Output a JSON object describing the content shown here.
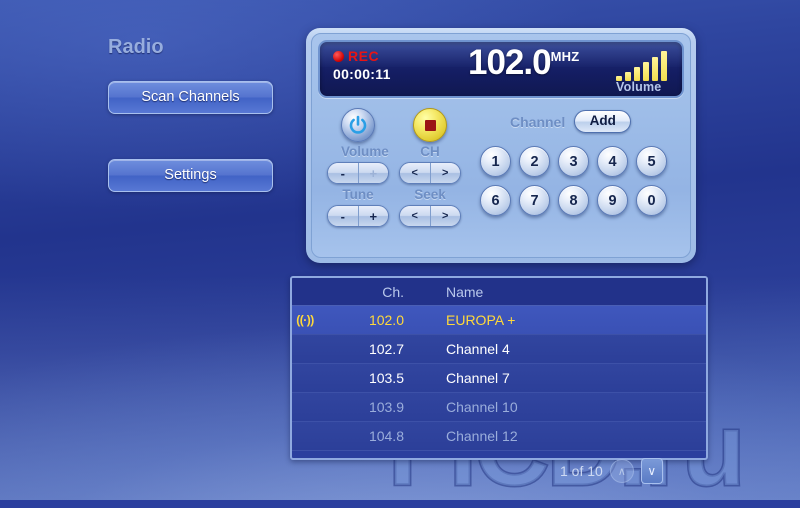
{
  "app": {
    "title": "Radio"
  },
  "sidebar": {
    "buttons": [
      {
        "label": "Scan Channels",
        "name": "scan-channels-button"
      },
      {
        "label": "Settings",
        "name": "settings-button"
      }
    ]
  },
  "display": {
    "rec_label": "REC",
    "rec_timer": "00:00:11",
    "frequency": "102.0",
    "frequency_unit": "MHZ",
    "volume_label": "Volume",
    "volume_bars": [
      5,
      9,
      14,
      19,
      24,
      30
    ],
    "volume_bar_count": 6
  },
  "controls": {
    "power_icon": "power-icon",
    "power_label": "Volume",
    "stop_icon": "stop-icon",
    "stop_label": "CH",
    "volume_minus": "-",
    "volume_plus": "+",
    "volume_plus_disabled": true,
    "ch_prev": "<",
    "ch_next": ">",
    "tune_label": "Tune",
    "tune_minus": "-",
    "tune_plus": "+",
    "seek_label": "Seek",
    "seek_prev": "<",
    "seek_next": ">",
    "channel_label": "Channel",
    "add_label": "Add",
    "keypad_row1": [
      "1",
      "2",
      "3",
      "4",
      "5"
    ],
    "keypad_row2": [
      "6",
      "7",
      "8",
      "9",
      "0"
    ]
  },
  "channel_list": {
    "headers": {
      "ch": "Ch.",
      "name": "Name"
    },
    "rows": [
      {
        "signal": "((·))",
        "ch": "102.0",
        "name": "EUROPA +",
        "selected": true,
        "faded": false
      },
      {
        "signal": "",
        "ch": "102.7",
        "name": "Channel 4",
        "selected": false,
        "faded": false
      },
      {
        "signal": "",
        "ch": "103.5",
        "name": "Channel 7",
        "selected": false,
        "faded": false
      },
      {
        "signal": "",
        "ch": "103.9",
        "name": "Channel 10",
        "selected": false,
        "faded": true
      },
      {
        "signal": "",
        "ch": "104.8",
        "name": "Channel 12",
        "selected": false,
        "faded": true
      }
    ]
  },
  "pager": {
    "text": "1 of 10",
    "up_icon": "∧",
    "down_icon": "∨"
  },
  "watermark": {
    "text": "FiCD.ru"
  },
  "colors": {
    "accent_yellow": "#ffd93a",
    "rec_red": "#e81414",
    "panel_blue": "#9ebde8",
    "background_blue": "#2b3f9e"
  }
}
